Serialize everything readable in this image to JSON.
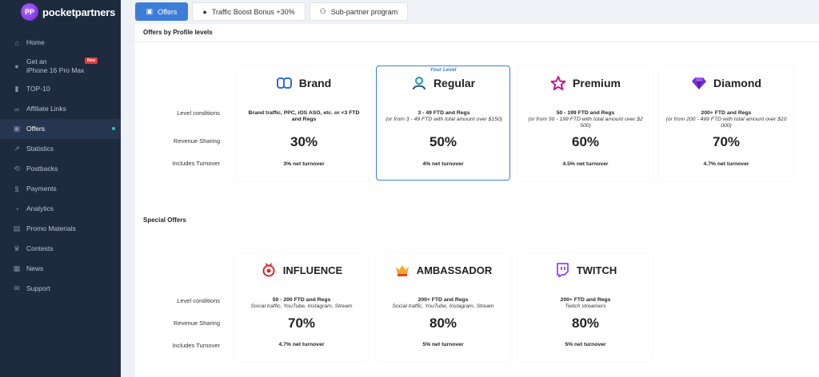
{
  "app": {
    "name": "pocketpartners",
    "logo_mark": "PP"
  },
  "sidebar": {
    "items": [
      {
        "icon": "home-icon",
        "glyph": "⌂",
        "label": "Home"
      },
      {
        "icon": "apple-icon",
        "glyph": "●",
        "label": "Get an\niPhone 16 Pro Max",
        "badge": "New"
      },
      {
        "icon": "top-chart-icon",
        "glyph": "▮",
        "label": "TOP-10"
      },
      {
        "icon": "link-icon",
        "glyph": "∞",
        "label": "Affiliate Links"
      },
      {
        "icon": "briefcase-icon",
        "glyph": "▣",
        "label": "Offers",
        "active": true
      },
      {
        "icon": "statistics-icon",
        "glyph": "↗",
        "label": "Statistics"
      },
      {
        "icon": "postbacks-icon",
        "glyph": "⟲",
        "label": "Postbacks"
      },
      {
        "icon": "payments-icon",
        "glyph": "$",
        "label": "Payments"
      },
      {
        "icon": "analytics-icon",
        "glyph": "◔",
        "label": "Analytics"
      },
      {
        "icon": "promo-materials-icon",
        "glyph": "▤",
        "label": "Promo Materials"
      },
      {
        "icon": "trophy-icon",
        "glyph": "♛",
        "label": "Contests"
      },
      {
        "icon": "news-icon",
        "glyph": "▦",
        "label": "News"
      },
      {
        "icon": "support-icon",
        "glyph": "✉",
        "label": "Support"
      }
    ]
  },
  "tabs": [
    {
      "label": "Offers",
      "glyph": "▣",
      "active": true
    },
    {
      "label": "Traffic Boost Bonus +30%",
      "glyph": "●",
      "active": false
    },
    {
      "label": "Sub-partner program",
      "glyph": "⚇",
      "active": false
    }
  ],
  "levels": {
    "section_title": "Offers by Profile levels",
    "row_labels": {
      "conditions": "Level conditions",
      "revenue": "Revenue Sharing",
      "turnover": "Includes Turnover"
    },
    "your_level_label": "Your Level",
    "cards": [
      {
        "name": "Brand",
        "icon": "brand-icon",
        "cond_main": "Brand traffic, PPC, iOS ASO, etc. or <3 FTD and Regs",
        "cond_sub": "",
        "revenue": "30%",
        "turnover": "3% net turnover"
      },
      {
        "name": "Regular",
        "icon": "user-icon",
        "cond_main": "3 - 49 FTD and Regs",
        "cond_sub": "(or from 3 - 49 FTD with total amount over $150)",
        "revenue": "50%",
        "turnover": "4% net turnover",
        "current": true
      },
      {
        "name": "Premium",
        "icon": "star-icon",
        "cond_main": "50 - 199 FTD and Regs",
        "cond_sub": "(or from 50 - 199 FTD with total amount over $2 500)",
        "revenue": "60%",
        "turnover": "4.5% net turnover"
      },
      {
        "name": "Diamond",
        "icon": "diamond-icon",
        "cond_main": "200+ FTD and Regs",
        "cond_sub": "(or from 200 - 499 FTD with total amount over $10 000)",
        "revenue": "70%",
        "turnover": "4.7% net turnover"
      }
    ]
  },
  "special": {
    "section_title": "Special Offers",
    "row_labels": {
      "conditions": "Level conditions",
      "revenue": "Revenue Sharing",
      "turnover": "Includes Turnover"
    },
    "cards": [
      {
        "name": "INFLUENCE",
        "icon": "influence-icon",
        "cond_main": "50 - 200 FTD and Regs",
        "cond_sub": "Social traffic, YouTube, Instagram, Stream",
        "revenue": "70%",
        "turnover": "4.7% net turnover"
      },
      {
        "name": "AMBASSADOR",
        "icon": "crown-icon",
        "cond_main": "200+ FTD and Regs",
        "cond_sub": "Social traffic, YouTube, Instagram, Stream",
        "revenue": "80%",
        "turnover": "5% net turnover"
      },
      {
        "name": "TWITCH",
        "icon": "twitch-icon",
        "cond_main": "200+ FTD and Regs",
        "cond_sub": "Twitch streamers",
        "revenue": "80%",
        "turnover": "5% net turnover"
      }
    ]
  },
  "colors": {
    "sidebar_bg": "#1e2b3e",
    "accent": "#3d7dd8",
    "new_badge": "#e5393b"
  }
}
